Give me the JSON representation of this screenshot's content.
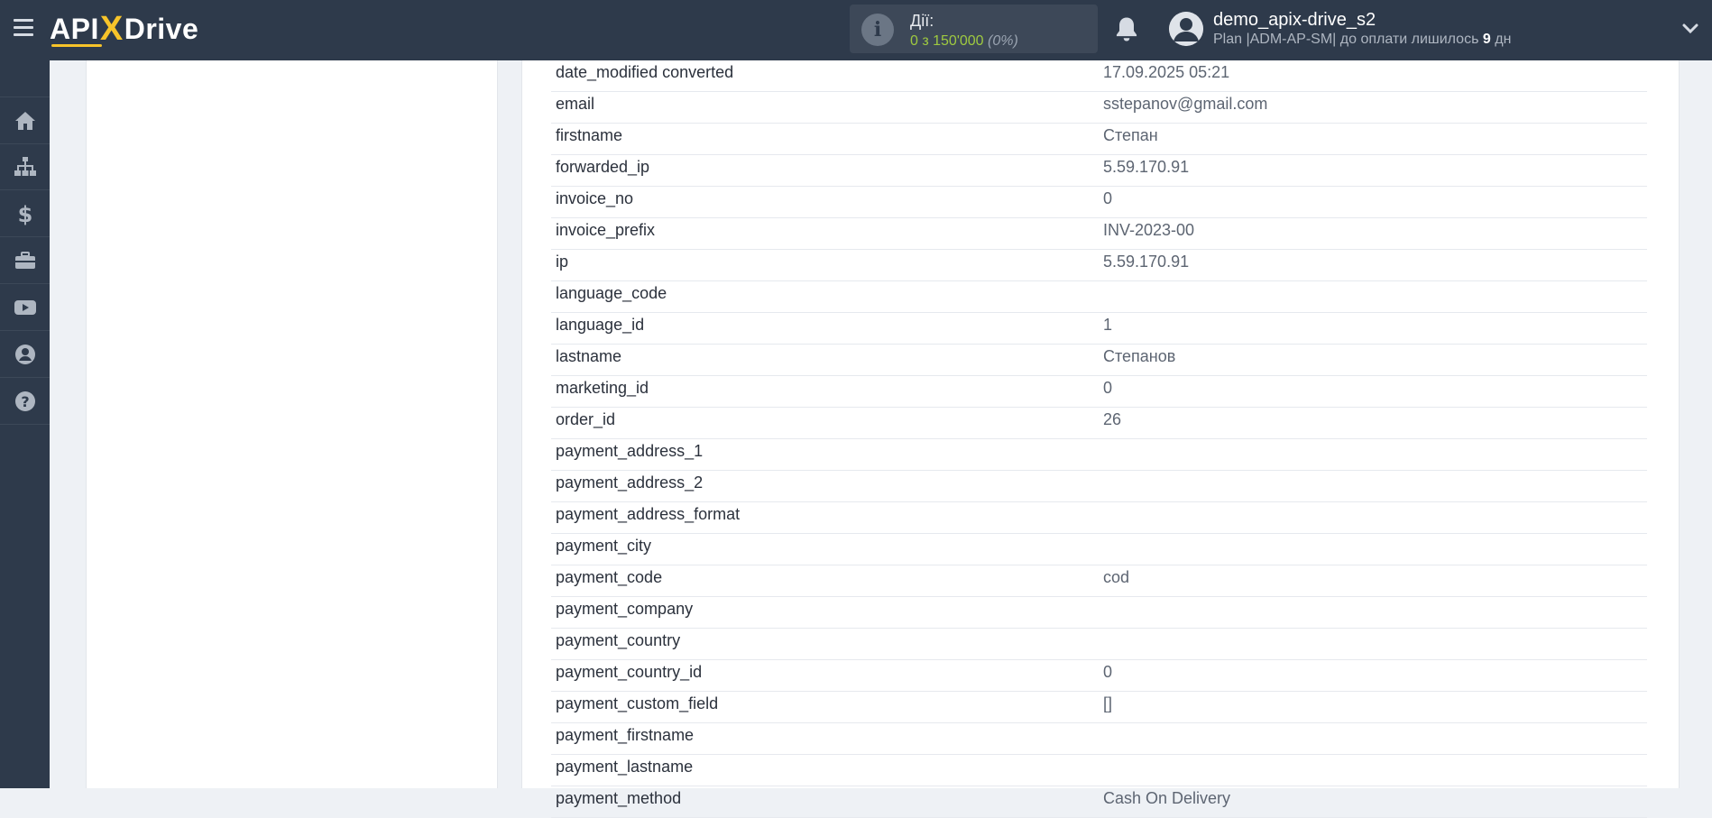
{
  "header": {
    "logo": {
      "part1": "API",
      "part2": "X",
      "part3": "Drive"
    },
    "actions": {
      "label": "Дії:",
      "count": "0 з 150'000",
      "percent": "(0%)"
    },
    "user": {
      "name": "demo_apix-drive_s2",
      "plan_prefix": "Plan |ADM-AP-SM| до оплати лишилось",
      "days": "9",
      "days_unit": "дн"
    }
  },
  "sidebar": {
    "items": [
      {
        "icon": "home-icon"
      },
      {
        "icon": "sitemap-icon"
      },
      {
        "icon": "dollar-icon"
      },
      {
        "icon": "briefcase-icon"
      },
      {
        "icon": "youtube-icon"
      },
      {
        "icon": "user-circle-icon"
      },
      {
        "icon": "help-icon"
      }
    ]
  },
  "fields": [
    {
      "key": "date_modified converted",
      "value": "17.09.2025 05:21"
    },
    {
      "key": "email",
      "value": "sstepanov@gmail.com"
    },
    {
      "key": "firstname",
      "value": "Степан"
    },
    {
      "key": "forwarded_ip",
      "value": "5.59.170.91"
    },
    {
      "key": "invoice_no",
      "value": "0"
    },
    {
      "key": "invoice_prefix",
      "value": "INV-2023-00"
    },
    {
      "key": "ip",
      "value": "5.59.170.91"
    },
    {
      "key": "language_code",
      "value": ""
    },
    {
      "key": "language_id",
      "value": "1"
    },
    {
      "key": "lastname",
      "value": "Степанов"
    },
    {
      "key": "marketing_id",
      "value": "0"
    },
    {
      "key": "order_id",
      "value": "26"
    },
    {
      "key": "payment_address_1",
      "value": ""
    },
    {
      "key": "payment_address_2",
      "value": ""
    },
    {
      "key": "payment_address_format",
      "value": ""
    },
    {
      "key": "payment_city",
      "value": ""
    },
    {
      "key": "payment_code",
      "value": "cod"
    },
    {
      "key": "payment_company",
      "value": ""
    },
    {
      "key": "payment_country",
      "value": ""
    },
    {
      "key": "payment_country_id",
      "value": "0"
    },
    {
      "key": "payment_custom_field",
      "value": "[]"
    },
    {
      "key": "payment_firstname",
      "value": ""
    },
    {
      "key": "payment_lastname",
      "value": ""
    },
    {
      "key": "payment_method",
      "value": "Cash On Delivery"
    }
  ]
}
